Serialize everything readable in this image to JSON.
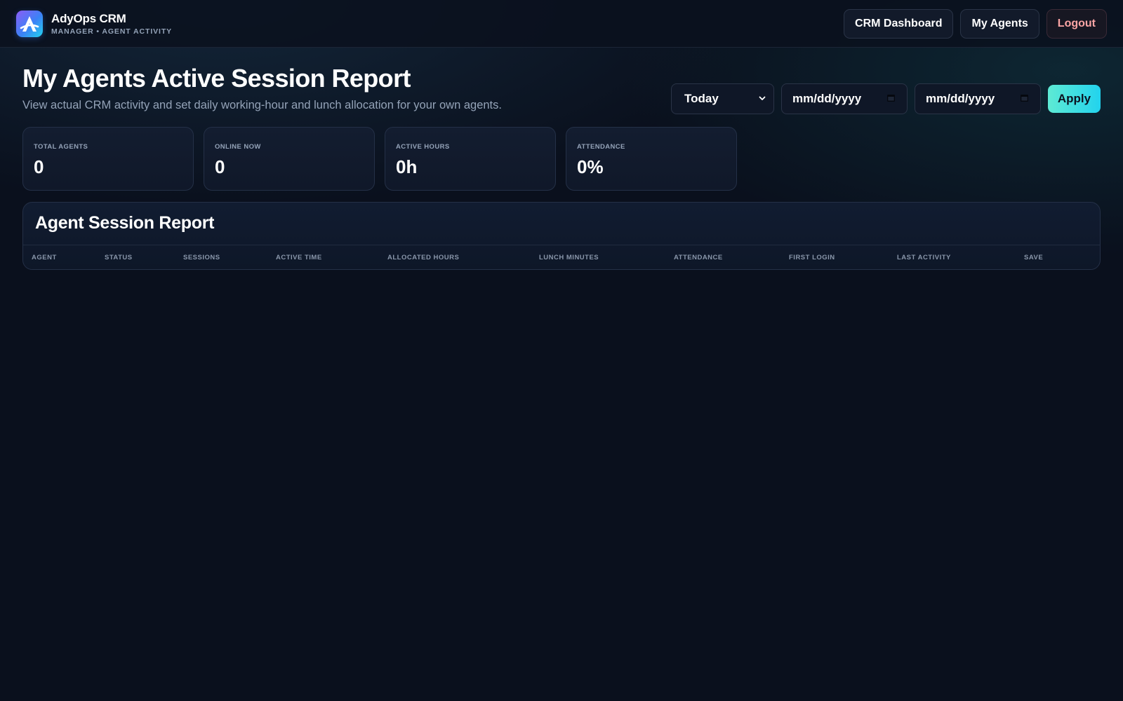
{
  "app": {
    "name": "AdyOps CRM",
    "subtitle": "MANAGER • AGENT ACTIVITY",
    "logo_letter": "A"
  },
  "nav": {
    "items": [
      {
        "label": "CRM Dashboard"
      },
      {
        "label": "My Agents"
      },
      {
        "label": "Logout"
      }
    ]
  },
  "header": {
    "title": "My Agents Active Session Report",
    "subtitle": "View actual CRM activity and set daily working-hour and lunch allocation for your own agents."
  },
  "filters": {
    "range_selected": "Today",
    "start_date_placeholder": "mm/dd/yyyy",
    "end_date_placeholder": "mm/dd/yyyy",
    "apply_label": "Apply"
  },
  "stats": [
    {
      "label": "TOTAL AGENTS",
      "value": "0"
    },
    {
      "label": "ONLINE NOW",
      "value": "0"
    },
    {
      "label": "ACTIVE HOURS",
      "value": "0h"
    },
    {
      "label": "ATTENDANCE",
      "value": "0%"
    }
  ],
  "report": {
    "title": "Agent Session Report",
    "columns": [
      "AGENT",
      "STATUS",
      "SESSIONS",
      "ACTIVE TIME",
      "ALLOCATED HOURS",
      "LUNCH MINUTES",
      "ATTENDANCE",
      "FIRST LOGIN",
      "LAST ACTIVITY",
      "SAVE"
    ],
    "rows": []
  },
  "colors": {
    "background": "#0a101d",
    "accent": "#22d3ee",
    "logout": "#fca5a5"
  }
}
